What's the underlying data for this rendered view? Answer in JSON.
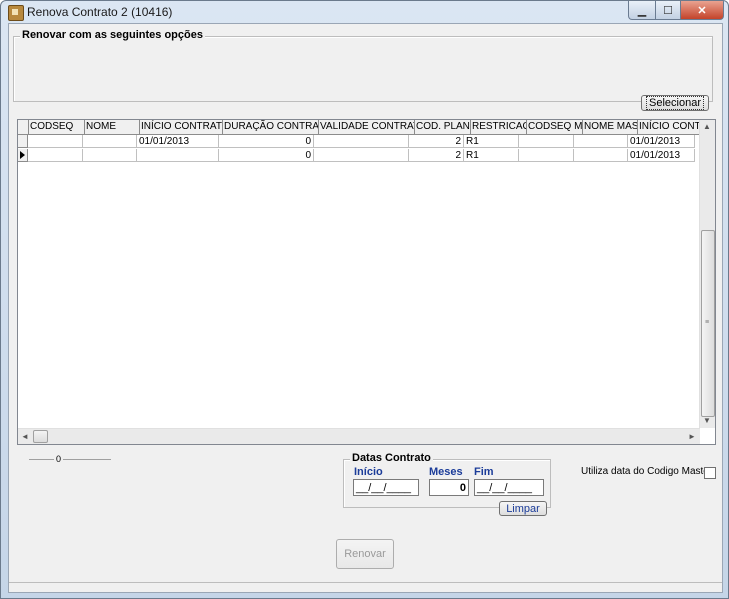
{
  "window": {
    "title": "Renova Contrato 2 (10416)"
  },
  "options_group": {
    "legend": "Renovar com as seguintes opções"
  },
  "select_button": {
    "label": "Selecionar"
  },
  "grid": {
    "headers": [
      "CODSEQ",
      "NOME",
      "INÍCIO CONTRATO",
      "DURAÇÃO CONTRATO",
      "VALIDADE CONTRATO",
      "COD. PLANO",
      "RESTRICAO",
      "CODSEQ MAS",
      "NOME MASTE",
      "INÍCIO CONTRAT"
    ],
    "rows": [
      [
        "",
        "",
        "01/01/2013",
        "0",
        "",
        "2",
        "R1",
        "",
        "",
        "01/01/2013"
      ],
      [
        "",
        "",
        "",
        "0",
        "",
        "2",
        "R1",
        "",
        "",
        "01/01/2013"
      ]
    ],
    "current_row": 1
  },
  "slider": {
    "value": "0"
  },
  "datas_group": {
    "legend": "Datas Contrato",
    "inicio_label": "Início",
    "meses_label": "Meses",
    "fim_label": "Fim",
    "inicio_value": "__/__/____",
    "meses_value": "0",
    "fim_value": "__/__/____",
    "limpar_label": "Limpar"
  },
  "master_checkbox": {
    "label": "Utiliza data do Codigo Master",
    "checked": false
  },
  "renovar_button": {
    "label": "Renovar",
    "disabled": true
  }
}
